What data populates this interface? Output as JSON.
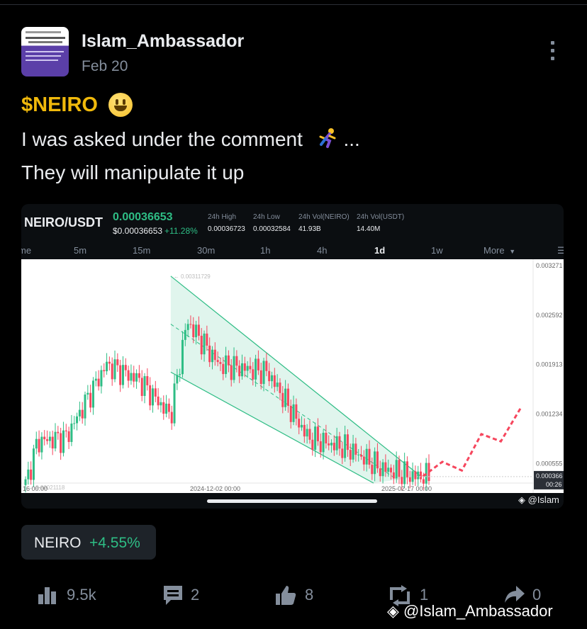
{
  "post": {
    "author": "Islam_Ambassador",
    "date": "Feb 20",
    "ticker": "$NEIRO",
    "line1": "I was asked under the comment",
    "line1_suffix": "...",
    "line2": "They will manipulate it up"
  },
  "market_card": {
    "pair": "NEIRO/USDT",
    "last_price": "0.00036653",
    "usd_price": "$0.00036653",
    "change": "+11.28%",
    "stats": [
      {
        "label": "24h High",
        "value": "0.00036723"
      },
      {
        "label": "24h Low",
        "value": "0.00032584"
      },
      {
        "label": "24h Vol(NEIRO)",
        "value": "41.93B"
      },
      {
        "label": "24h Vol(USDT)",
        "value": "14.40M"
      }
    ],
    "timeframes": [
      "me",
      "5m",
      "15m",
      "30m",
      "1h",
      "4h",
      "1d",
      "1w",
      "More"
    ],
    "active_timeframe": "1d",
    "price_axis": [
      "0.003271",
      "0.002592",
      "0.001913",
      "0.001234",
      "0.000555"
    ],
    "current_price_tag": "0.000366",
    "countdown_tag": "00:26",
    "high_marker": "0.00311729",
    "low_marker": "0.00021118",
    "x_axis": [
      "16 00:00",
      "2024-12-02 00:00",
      "2025-02-17 00:00"
    ],
    "watermark": "@Islam"
  },
  "coin_chip": {
    "name": "NEIRO",
    "change": "+4.55%"
  },
  "actions": {
    "views": "9.5k",
    "comments": "2",
    "likes": "8",
    "reposts": "1",
    "shares": "0"
  },
  "overlay_watermark": "@Islam_Ambassador",
  "colors": {
    "up": "#2ebd85",
    "down": "#f6465d",
    "accent": "#f0b90b",
    "muted": "#848e9c",
    "card_bg": "#0b0e11",
    "chip_bg": "#1e2329"
  },
  "chart_data": {
    "type": "candlestick",
    "x_range": [
      "2024-09-16",
      "2025-02-17"
    ],
    "y_range": [
      0.0002,
      0.003271
    ],
    "trend": [
      {
        "x": 0.0,
        "y": 0.00025
      },
      {
        "x": 0.03,
        "y": 0.00085
      },
      {
        "x": 0.1,
        "y": 0.0009
      },
      {
        "x": 0.2,
        "y": 0.0019
      },
      {
        "x": 0.28,
        "y": 0.0017
      },
      {
        "x": 0.36,
        "y": 0.0012
      },
      {
        "x": 0.4,
        "y": 0.0025
      },
      {
        "x": 0.48,
        "y": 0.0019
      },
      {
        "x": 0.6,
        "y": 0.0018
      },
      {
        "x": 0.7,
        "y": 0.0009
      },
      {
        "x": 0.8,
        "y": 0.00075
      },
      {
        "x": 0.88,
        "y": 0.00048
      },
      {
        "x": 0.96,
        "y": 0.00037
      }
    ],
    "projection": [
      {
        "label": "p0",
        "y": 0.00037
      },
      {
        "label": "p1",
        "y": 0.00057
      },
      {
        "label": "p2",
        "y": 0.00045
      },
      {
        "label": "p3",
        "y": 0.00095
      },
      {
        "label": "p4",
        "y": 0.00085
      },
      {
        "label": "p5",
        "y": 0.0013
      }
    ],
    "channel": {
      "upper": [
        0.00311729,
        0.00037
      ],
      "lower": [
        0.0018,
        -0.0004
      ]
    }
  }
}
